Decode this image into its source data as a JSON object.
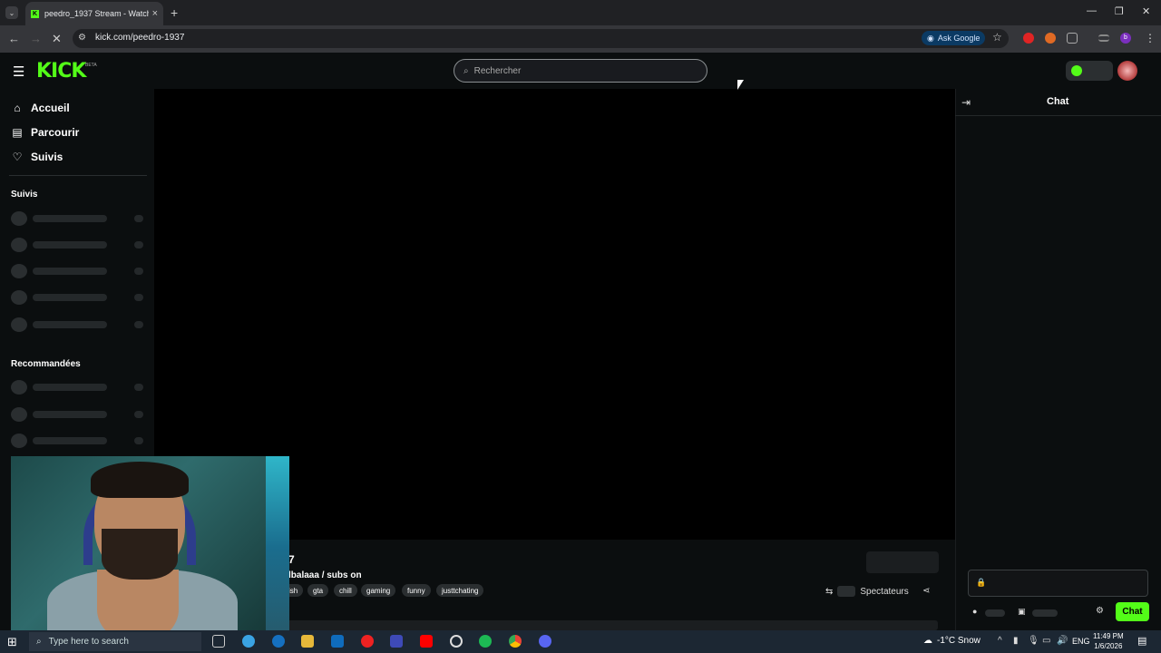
{
  "browser": {
    "tab_title": "peedro_1937 Stream - Watch Li",
    "url": "kick.com/peedro-1937",
    "ask_google": "Ask Google"
  },
  "site": {
    "logo": "KICK",
    "logo_badge": "BETA",
    "search_placeholder": "Rechercher",
    "nav": [
      {
        "label": "Accueil",
        "icon": "home-icon"
      },
      {
        "label": "Parcourir",
        "icon": "browse-icon"
      },
      {
        "label": "Suivis",
        "icon": "heart-icon"
      }
    ],
    "section_followed": "Suivis",
    "section_recommended": "Recommandées",
    "accent": "#53fc18"
  },
  "stream": {
    "title_fragment": "7",
    "subtitle_fragment": "lbalaaa / subs on",
    "tags": [
      "ish",
      "gta",
      "chill",
      "gaming",
      "funny",
      "justtchating"
    ],
    "viewers_label": "Spectateurs"
  },
  "chat": {
    "title": "Chat",
    "send_label": "Chat"
  },
  "taskbar": {
    "search_placeholder": "Type here to search",
    "weather": "-1°C  Snow",
    "language": "ENG",
    "time": "11:49 PM",
    "date": "1/6/2026",
    "notifications": "13"
  }
}
